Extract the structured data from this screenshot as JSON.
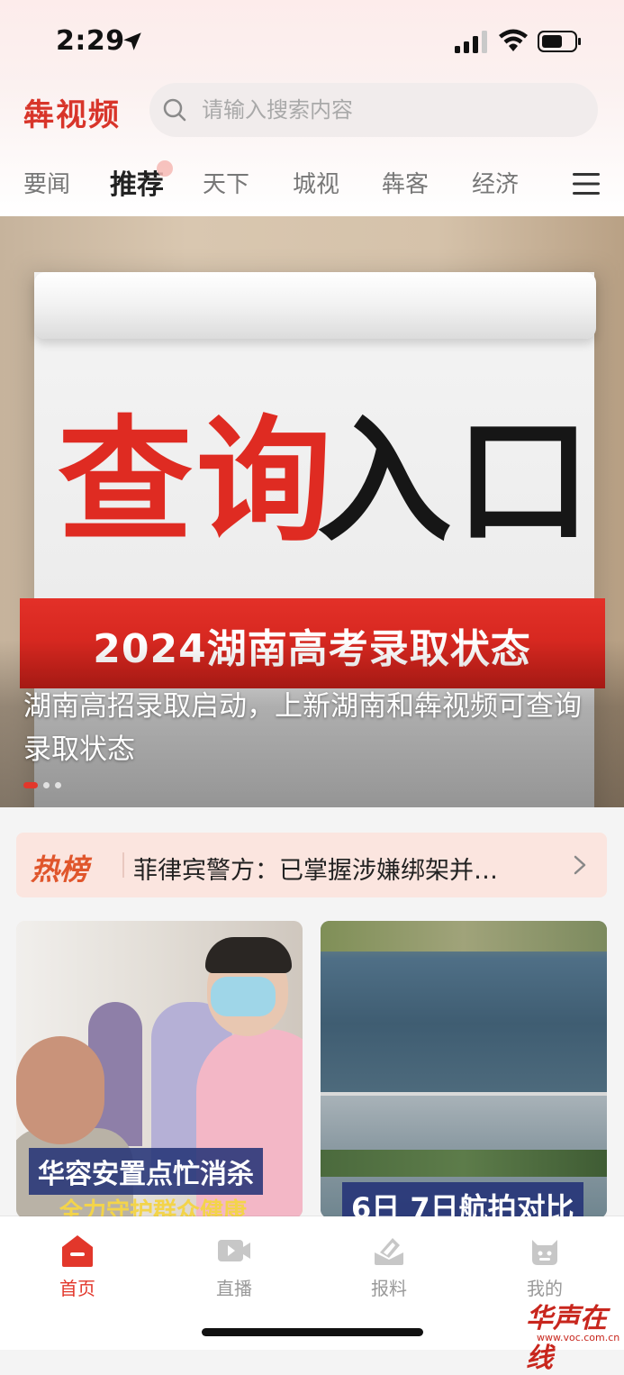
{
  "status_bar": {
    "time": "2:29"
  },
  "header": {
    "logo": "犇视频",
    "search_placeholder": "请输入搜索内容"
  },
  "tabs": [
    {
      "label": "要闻"
    },
    {
      "label": "推荐",
      "active": true
    },
    {
      "label": "天下"
    },
    {
      "label": "城视"
    },
    {
      "label": "犇客"
    },
    {
      "label": "经济"
    }
  ],
  "banner": {
    "query_red": "查询",
    "query_black": "入口",
    "ribbon": "2024湖南高考录取状态",
    "caption": "湖南高招录取启动，上新湖南和犇视频可查询录取状态",
    "slide_count": 3,
    "active_slide": 1
  },
  "hot": {
    "label": "热榜",
    "text": "菲律宾警方：已掌握涉嫌绑架并…"
  },
  "cards": [
    {
      "caption": "华容安置点忙消杀",
      "subcaption": "全力守护群众健康"
    },
    {
      "caption": "6日 7日航拍对比"
    }
  ],
  "bottom_nav": [
    {
      "label": "首页",
      "icon": "home-icon",
      "active": true
    },
    {
      "label": "直播",
      "icon": "live-video-icon"
    },
    {
      "label": "报料",
      "icon": "report-icon"
    },
    {
      "label": "我的",
      "icon": "profile-icon"
    }
  ],
  "watermark": {
    "text": "华声在线",
    "url": "www.voc.com.cn"
  },
  "colors": {
    "accent": "#e2372b",
    "hot": "#e0562c",
    "hot_bg": "#fbe5df"
  }
}
